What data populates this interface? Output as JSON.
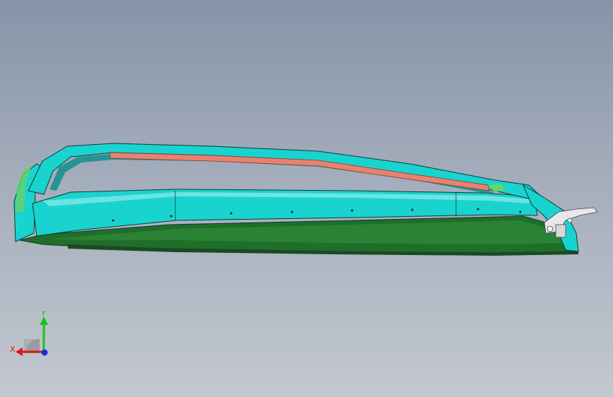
{
  "viewport": {
    "background_top": "#8794a8",
    "background_bottom": "#c3c8d0"
  },
  "model": {
    "colors": {
      "frame": "#19d3cf",
      "frame_dark": "#0f8f8c",
      "edge": "#0a3a34",
      "seal_strip": "#e8826f",
      "base": "#1f6e2a",
      "base_light": "#2f8a3a",
      "accent_green": "#67d16a",
      "hardware": "#e8e8ea"
    }
  },
  "triad": {
    "x_label": "X",
    "y_label": "Y",
    "x_color": "#e0151b",
    "y_color": "#18c21a",
    "z_color": "#1c2fe0"
  }
}
